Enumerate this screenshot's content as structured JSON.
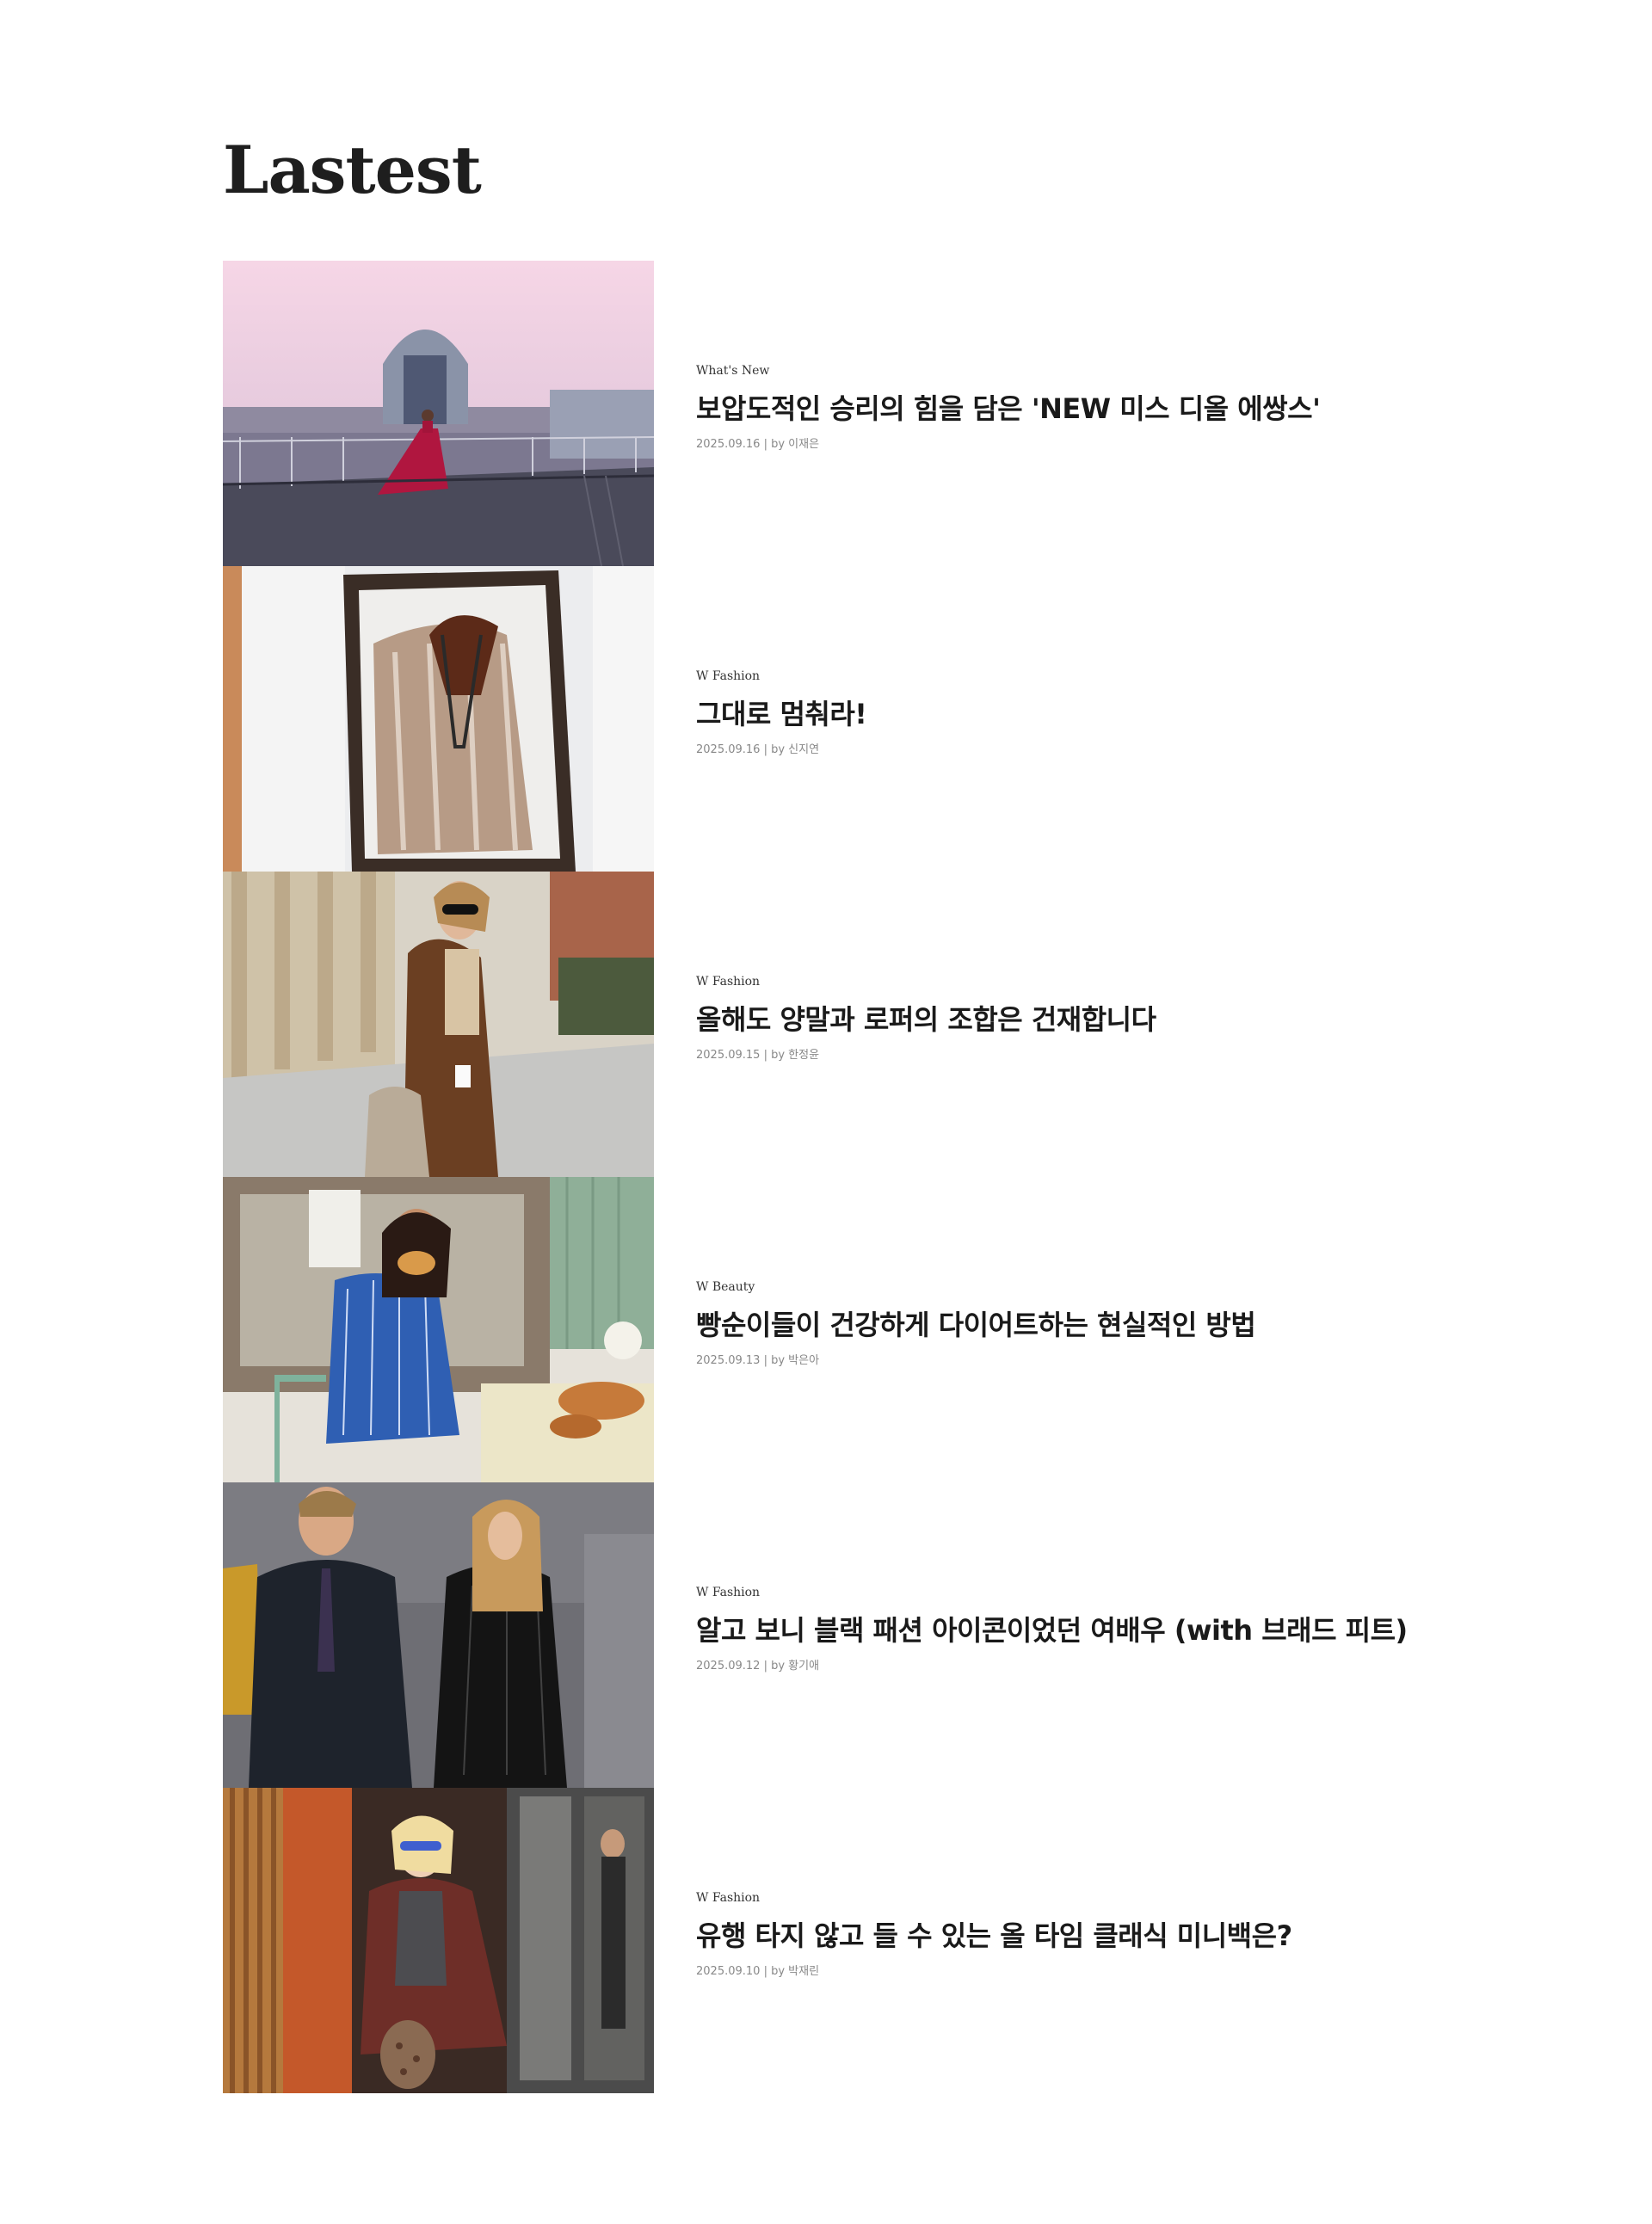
{
  "section": {
    "title": "Lastest"
  },
  "articles": [
    {
      "category": "What's New",
      "headline": "보압도적인 승리의 힘을 담은 'NEW 미스 디올 에쌍스'",
      "date": "2025.09.16",
      "author": "by 이재은",
      "image": "woman-in-red-dress-on-paris-rooftop"
    },
    {
      "category": "W Fashion",
      "headline": "그대로 멈춰라!",
      "date": "2025.09.16",
      "author": "by 신지연",
      "image": "fur-coat-in-wooden-frame"
    },
    {
      "category": "W Fashion",
      "headline": "올해도 양말과 로퍼의 조합은 건재합니다",
      "date": "2025.09.15",
      "author": "by 한정윤",
      "image": "woman-in-suede-jacket-street"
    },
    {
      "category": "W Beauty",
      "headline": "빵순이들이 건강하게 다이어트하는 현실적인 방법",
      "date": "2025.09.13",
      "author": "by 박은아",
      "image": "woman-eating-croissant"
    },
    {
      "category": "W Fashion",
      "headline": "알고 보니 블랙 패션 아이콘이었던 여배우 (with 브래드 피트)",
      "date": "2025.09.12",
      "author": "by 황기애",
      "image": "couple-in-black-outfits"
    },
    {
      "category": "W Fashion",
      "headline": "유행 타지 않고 들 수 있는 올 타임 클래식 미니백은?",
      "date": "2025.09.10",
      "author": "by 박재린",
      "image": "blonde-woman-leather-jacket-bag"
    }
  ],
  "separator": " | "
}
